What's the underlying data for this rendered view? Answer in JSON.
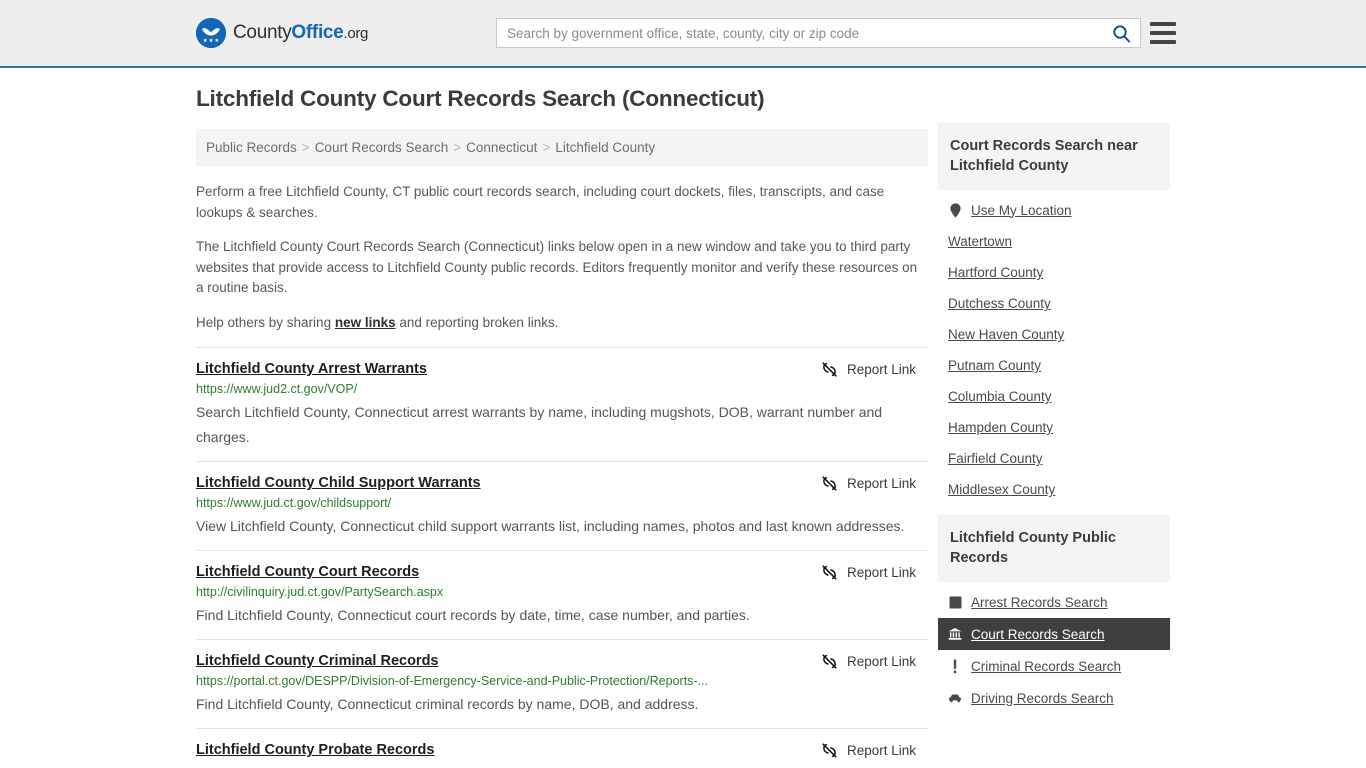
{
  "header": {
    "logo": {
      "part1": "County",
      "part2": "Office",
      "part3": ".org"
    },
    "search": {
      "placeholder": "Search by government office, state, county, city or zip code",
      "value": ""
    },
    "search_icon": "search-icon",
    "menu_icon": "hamburger-menu-icon"
  },
  "main": {
    "title": "Litchfield County Court Records Search (Connecticut)",
    "breadcrumb": [
      "Public Records",
      "Court Records Search",
      "Connecticut",
      "Litchfield County"
    ],
    "breadcrumb_separator": ">",
    "intro": {
      "p1": "Perform a free Litchfield County, CT public court records search, including court dockets, files, transcripts, and case lookups & searches.",
      "p2": "The Litchfield County Court Records Search (Connecticut) links below open in a new window and take you to third party websites that provide access to Litchfield County public records. Editors frequently monitor and verify these resources on a routine basis.",
      "p3_before": "Help others by sharing ",
      "p3_link": "new links",
      "p3_after": " and reporting broken links."
    },
    "report_link_label": "Report Link",
    "report_link_icon": "broken-link-icon",
    "results": [
      {
        "title": "Litchfield County Arrest Warrants",
        "url": "https://www.jud2.ct.gov/VOP/",
        "description": "Search Litchfield County, Connecticut arrest warrants by name, including mugshots, DOB, warrant number and charges."
      },
      {
        "title": "Litchfield County Child Support Warrants",
        "url": "https://www.jud.ct.gov/childsupport/",
        "description": "View Litchfield County, Connecticut child support warrants list, including names, photos and last known addresses."
      },
      {
        "title": "Litchfield County Court Records",
        "url": "http://civilinquiry.jud.ct.gov/PartySearch.aspx",
        "description": "Find Litchfield County, Connecticut court records by date, time, case number, and parties."
      },
      {
        "title": "Litchfield County Criminal Records",
        "url": "https://portal.ct.gov/DESPP/Division-of-Emergency-Service-and-Public-Protection/Reports-...",
        "description": "Find Litchfield County, Connecticut criminal records by name, DOB, and address."
      },
      {
        "title": "Litchfield County Probate Records",
        "url": "",
        "description": ""
      }
    ]
  },
  "sidebar": {
    "panel_near": {
      "heading": "Court Records Search near Litchfield County",
      "items": [
        {
          "label": "Use My Location",
          "icon": "location-pin-icon",
          "active": false
        },
        {
          "label": "Watertown",
          "icon": "",
          "active": false
        },
        {
          "label": "Hartford County",
          "icon": "",
          "active": false
        },
        {
          "label": "Dutchess County",
          "icon": "",
          "active": false
        },
        {
          "label": "New Haven County",
          "icon": "",
          "active": false
        },
        {
          "label": "Putnam County",
          "icon": "",
          "active": false
        },
        {
          "label": "Columbia County",
          "icon": "",
          "active": false
        },
        {
          "label": "Hampden County",
          "icon": "",
          "active": false
        },
        {
          "label": "Fairfield County",
          "icon": "",
          "active": false
        },
        {
          "label": "Middlesex County",
          "icon": "",
          "active": false
        }
      ]
    },
    "panel_public_records": {
      "heading": "Litchfield County Public Records",
      "items": [
        {
          "label": "Arrest Records Search",
          "icon": "fingerprint-card-icon",
          "active": false
        },
        {
          "label": "Court Records Search",
          "icon": "courthouse-icon",
          "active": true
        },
        {
          "label": "Criminal Records Search",
          "icon": "exclamation-icon",
          "active": false
        },
        {
          "label": "Driving Records Search",
          "icon": "car-icon",
          "active": false
        }
      ]
    }
  },
  "colors": {
    "brand_blue": "#1565b8",
    "header_border": "#3a6f9f",
    "url_green": "#2e7d32",
    "active_bg": "#3f3f3f",
    "panel_bg": "#f4f4f4"
  }
}
